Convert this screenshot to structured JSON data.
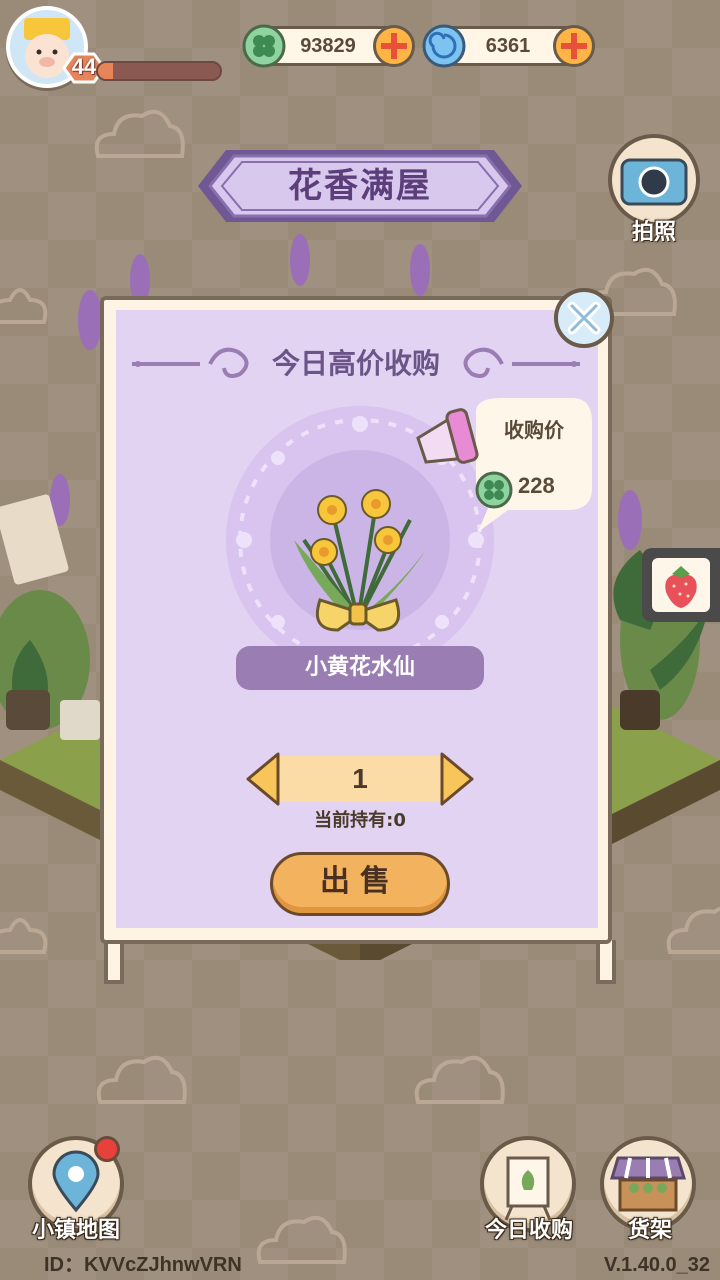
{
  "player": {
    "level": "44",
    "xp_fraction": 0.12
  },
  "currencies": [
    {
      "icon": "clover-coin-icon",
      "amount": "93829"
    },
    {
      "icon": "swirl-gem-icon",
      "amount": "6361"
    }
  ],
  "shop_title": "花香满屋",
  "camera": {
    "label": "拍照"
  },
  "panel": {
    "heading": "今日高价收购",
    "price_label": "收购价",
    "price_value": "228",
    "item_name": "小黄花水仙",
    "quantity": "1",
    "owned_text": "当前持有:0",
    "sell_label": "出售"
  },
  "bottom": {
    "map_label": "小镇地图",
    "purchase_label": "今日收购",
    "shelf_label": "货架"
  },
  "footer": {
    "id_text": "ID：KVVcZJhnwVRN",
    "version": "V.1.40.0_32"
  },
  "colors": {
    "panel_purple": "#e2d3f3",
    "title_purple": "#5b3e7a",
    "sell_orange": "#f3b35e"
  }
}
